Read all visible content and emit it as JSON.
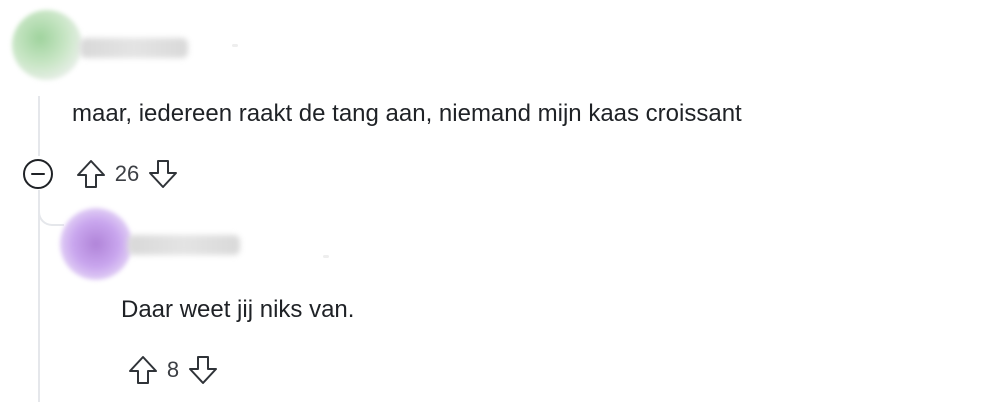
{
  "comments": [
    {
      "text": "maar, iedereen raakt de tang aan, niemand mijn kaas croissant",
      "votes": "26",
      "collapse_icon": "minus-circle-icon",
      "upvote_icon": "arrow-up-icon",
      "downvote_icon": "arrow-down-icon"
    },
    {
      "text": "Daar weet jij niks van.",
      "votes": "8",
      "upvote_icon": "arrow-up-icon",
      "downvote_icon": "arrow-down-icon"
    }
  ],
  "colors": {
    "text": "#1f2226",
    "thread_line": "#e5e7eb",
    "icon": "#2f3338"
  }
}
